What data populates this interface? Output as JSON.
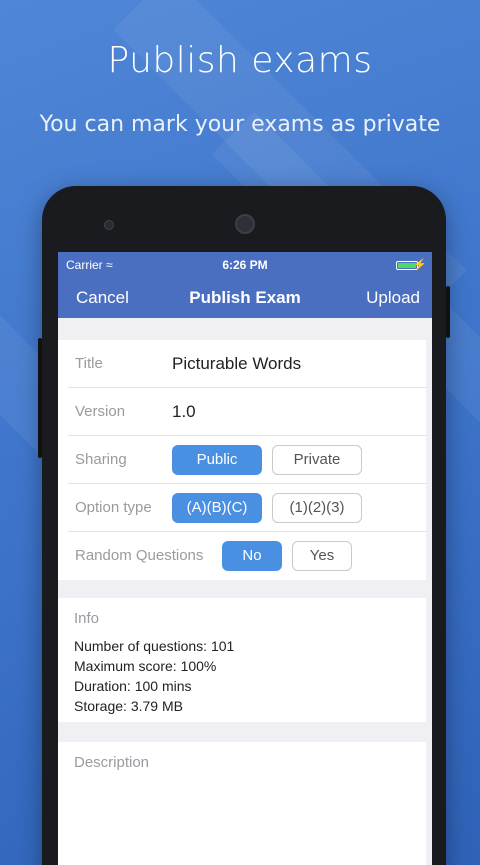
{
  "promo": {
    "headline": "Publish exams",
    "subhead": "You can mark your exams as private"
  },
  "status_bar": {
    "carrier": "Carrier",
    "time": "6:26 PM",
    "battery_level": 1.0
  },
  "nav": {
    "cancel": "Cancel",
    "title": "Publish Exam",
    "upload": "Upload"
  },
  "form": {
    "title_label": "Title",
    "title_value": "Picturable Words",
    "version_label": "Version",
    "version_value": "1.0",
    "sharing_label": "Sharing",
    "sharing_options": [
      "Public",
      "Private"
    ],
    "sharing_selected": "Public",
    "option_type_label": "Option type",
    "option_type_options": [
      "(A)(B)(C)",
      "(1)(2)(3)"
    ],
    "option_type_selected": "(A)(B)(C)",
    "random_label": "Random Questions",
    "random_options": [
      "No",
      "Yes"
    ],
    "random_selected": "No"
  },
  "info": {
    "title": "Info",
    "lines": [
      "Number of questions: 101",
      "Maximum score: 100%",
      "Duration: 100 mins",
      "Storage: 3.79 MB"
    ]
  },
  "description": {
    "label": "Description",
    "value": ""
  },
  "colors": {
    "background": "#3f76cc",
    "navbar": "#4a6fc1",
    "segment_active": "#4a90e2",
    "battery": "#4cd964"
  }
}
